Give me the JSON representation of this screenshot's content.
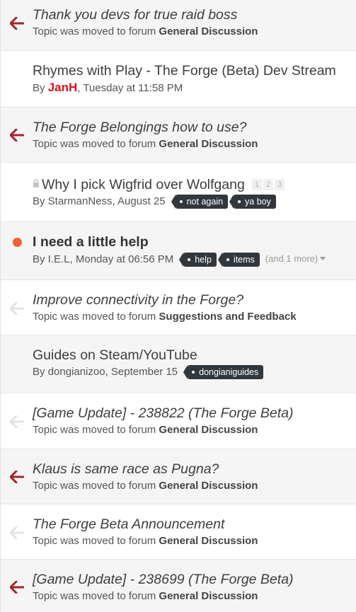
{
  "topics": [
    {
      "title": "Thank you devs for true raid boss",
      "moved_prefix": "Topic was moved to forum ",
      "forum": "General Discussion"
    },
    {
      "title": "Rhymes with Play - The Forge (Beta) Dev Stream",
      "by": "By ",
      "author": "JanH",
      "date": ", Tuesday at 11:58 PM"
    },
    {
      "title": "The Forge Belongings how to use?",
      "moved_prefix": "Topic was moved to forum ",
      "forum": "General Discussion"
    },
    {
      "title": "Why I pick Wigfrid over Wolfgang",
      "pages": [
        "1",
        "2",
        "3"
      ],
      "meta": "By StarmanNess, August 25",
      "tags": [
        "not again",
        "ya boy"
      ]
    },
    {
      "title": "I need a little help",
      "meta": "By I.E.L, Monday at 06:56 PM",
      "tags": [
        "help",
        "items"
      ],
      "more": "(and 1 more)"
    },
    {
      "title": "Improve connectivity in the Forge?",
      "moved_prefix": "Topic was moved to forum ",
      "forum": "Suggestions and Feedback"
    },
    {
      "title": "Guides on Steam/YouTube",
      "meta": "By dongianizoo, September 15",
      "tags": [
        "dongianiguides"
      ]
    },
    {
      "title": "[Game Update] - 238822 (The Forge Beta)",
      "moved_prefix": "Topic was moved to forum ",
      "forum": "General Discussion"
    },
    {
      "title": "Klaus is same race as Pugna?",
      "moved_prefix": "Topic was moved to forum ",
      "forum": "General Discussion"
    },
    {
      "title": "The Forge Beta Announcement",
      "moved_prefix": "Topic was moved to forum ",
      "forum": "General Discussion"
    },
    {
      "title": "[Game Update] - 238699 (The Forge Beta)",
      "moved_prefix": "Topic was moved to forum ",
      "forum": "General Discussion"
    }
  ],
  "colors": {
    "arrow_red": "#a3262a",
    "arrow_faded": "#e3e3e3",
    "unread_dot": "#ee6133",
    "tag_bg": "#32373c",
    "author_red": "#d6121a"
  },
  "icons": {
    "moved_active": "arrow-left-icon",
    "moved_faded": "arrow-left-icon",
    "unread": "unread-dot-icon",
    "locked": "lock-icon"
  }
}
